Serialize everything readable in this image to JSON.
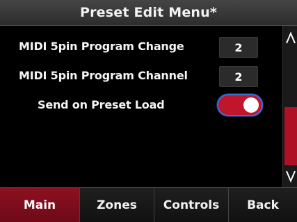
{
  "title": "Preset Edit Menu*",
  "rows": [
    {
      "label": "MIDI 5pin Program Change",
      "value": "2"
    },
    {
      "label": "MIDI 5pin Program Channel",
      "value": "2"
    }
  ],
  "toggle_row": {
    "label": "Send on Preset Load",
    "state": "on"
  },
  "scrollbar": {
    "up_icon": "caret-up-icon",
    "down_icon": "caret-down-icon"
  },
  "tabs": [
    {
      "label": "Main",
      "active": true
    },
    {
      "label": "Zones",
      "active": false
    },
    {
      "label": "Controls",
      "active": false
    },
    {
      "label": "Back",
      "active": false
    }
  ],
  "colors": {
    "accent_red": "#c0152b",
    "active_tab": "#8d1020",
    "toggle_outline": "#3b6fd6"
  }
}
